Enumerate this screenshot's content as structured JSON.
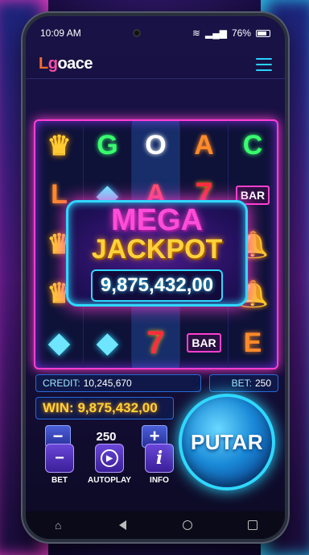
{
  "status": {
    "time": "10:09 AM",
    "battery": "76%"
  },
  "header": {
    "logo_l": "L",
    "logo_g": "g",
    "logo_rest": "oace"
  },
  "reels": [
    [
      {
        "t": "crown"
      },
      {
        "t": "letter",
        "v": "G",
        "c": "#39ff6e"
      },
      {
        "t": "letter",
        "v": "O",
        "c": "#ffffff"
      },
      {
        "t": "letter",
        "v": "A",
        "c": "#ff8a2a"
      },
      {
        "t": "letter",
        "v": "C",
        "c": "#39ff6e"
      }
    ],
    [
      {
        "t": "letter",
        "v": "L",
        "c": "#ff8a2a"
      },
      {
        "t": "diamond"
      },
      {
        "t": "letter",
        "v": "A",
        "c": "#ff4d6d"
      },
      {
        "t": "seven"
      },
      {
        "t": "bar",
        "v": "BAR"
      }
    ],
    [
      {
        "t": "crown"
      },
      {
        "t": "empty"
      },
      {
        "t": "empty"
      },
      {
        "t": "empty"
      },
      {
        "t": "bell"
      }
    ],
    [
      {
        "t": "crown"
      },
      {
        "t": "empty"
      },
      {
        "t": "empty"
      },
      {
        "t": "empty"
      },
      {
        "t": "bell"
      }
    ],
    [
      {
        "t": "diamond"
      },
      {
        "t": "diamond"
      },
      {
        "t": "seven"
      },
      {
        "t": "bar",
        "v": "BAR"
      },
      {
        "t": "letter",
        "v": "E",
        "c": "#ff8a2a"
      }
    ]
  ],
  "jackpot": {
    "line1": "MEGA",
    "line2": "JACKPOT",
    "amount": "9,875,432,00"
  },
  "credit": {
    "label": "CREDIT:",
    "value": "10,245,670"
  },
  "bet": {
    "label": "BET:",
    "value": "250"
  },
  "win": {
    "label": "WIN:",
    "value": "9,875,432,00"
  },
  "stepper": {
    "minus": "−",
    "value": "250",
    "plus": "+"
  },
  "controls": {
    "bet_label": "BET",
    "autoplay_label": "AUTOPLAY",
    "info_label": "INFO"
  },
  "putar": {
    "label": "PUTAR"
  },
  "colors": {
    "neon_pink": "#ff3fd0",
    "neon_cyan": "#2fd8ff",
    "gold": "#ffd23a"
  }
}
